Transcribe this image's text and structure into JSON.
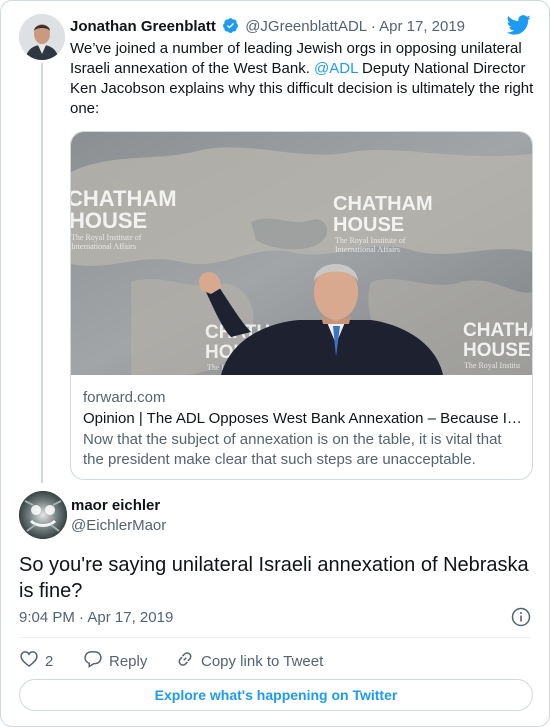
{
  "parent_tweet": {
    "author_name": "Jonathan Greenblatt",
    "handle": "@JGreenblattADL",
    "separator": "·",
    "date": "Apr 17, 2019",
    "text_before": "We’ve joined a number of leading Jewish orgs in opposing unilateral Israeli annexation of the West Bank. ",
    "mention": "@ADL",
    "text_after": " Deputy National Director Ken Jacobson explains why this difficult decision is ultimately the right one:",
    "link_card": {
      "domain": "forward.com",
      "title": "Opinion | The ADL Opposes West Bank Annexation – Because It’s Bad For Israel",
      "description": "Now that the subject of annexation is on the table, it is vital that the president make clear that such steps are unacceptable.",
      "image_text": {
        "chatham_large": "CHATHAM",
        "house_large": "HOUSE",
        "royal_line1": "The Royal Institute of",
        "royal_line2": "International Affairs",
        "chatham_left": "CHATHAM",
        "house_left": "HOUSE",
        "chatham_lower": "CHATHAM",
        "house_lower": "HOUSE",
        "royal_lower": "The Royal",
        "chatham_right": "CHATHA",
        "house_right": "HOUSE",
        "royal_right": "The Royal Institu"
      }
    }
  },
  "reply_tweet": {
    "author_name": "maor eichler",
    "handle": "@EichlerMaor",
    "text": "So you're saying unilateral Israeli annexation of Nebraska is fine?",
    "time": "9:04 PM",
    "separator": "·",
    "date": "Apr 17, 2019"
  },
  "actions": {
    "like_count": "2",
    "reply_label": "Reply",
    "copy_link_label": "Copy link to Tweet"
  },
  "explore_label": "Explore what's happening on Twitter",
  "colors": {
    "accent": "#1d9bf0",
    "text": "#0f1419",
    "muted": "#536471",
    "border": "#cfd9de"
  }
}
